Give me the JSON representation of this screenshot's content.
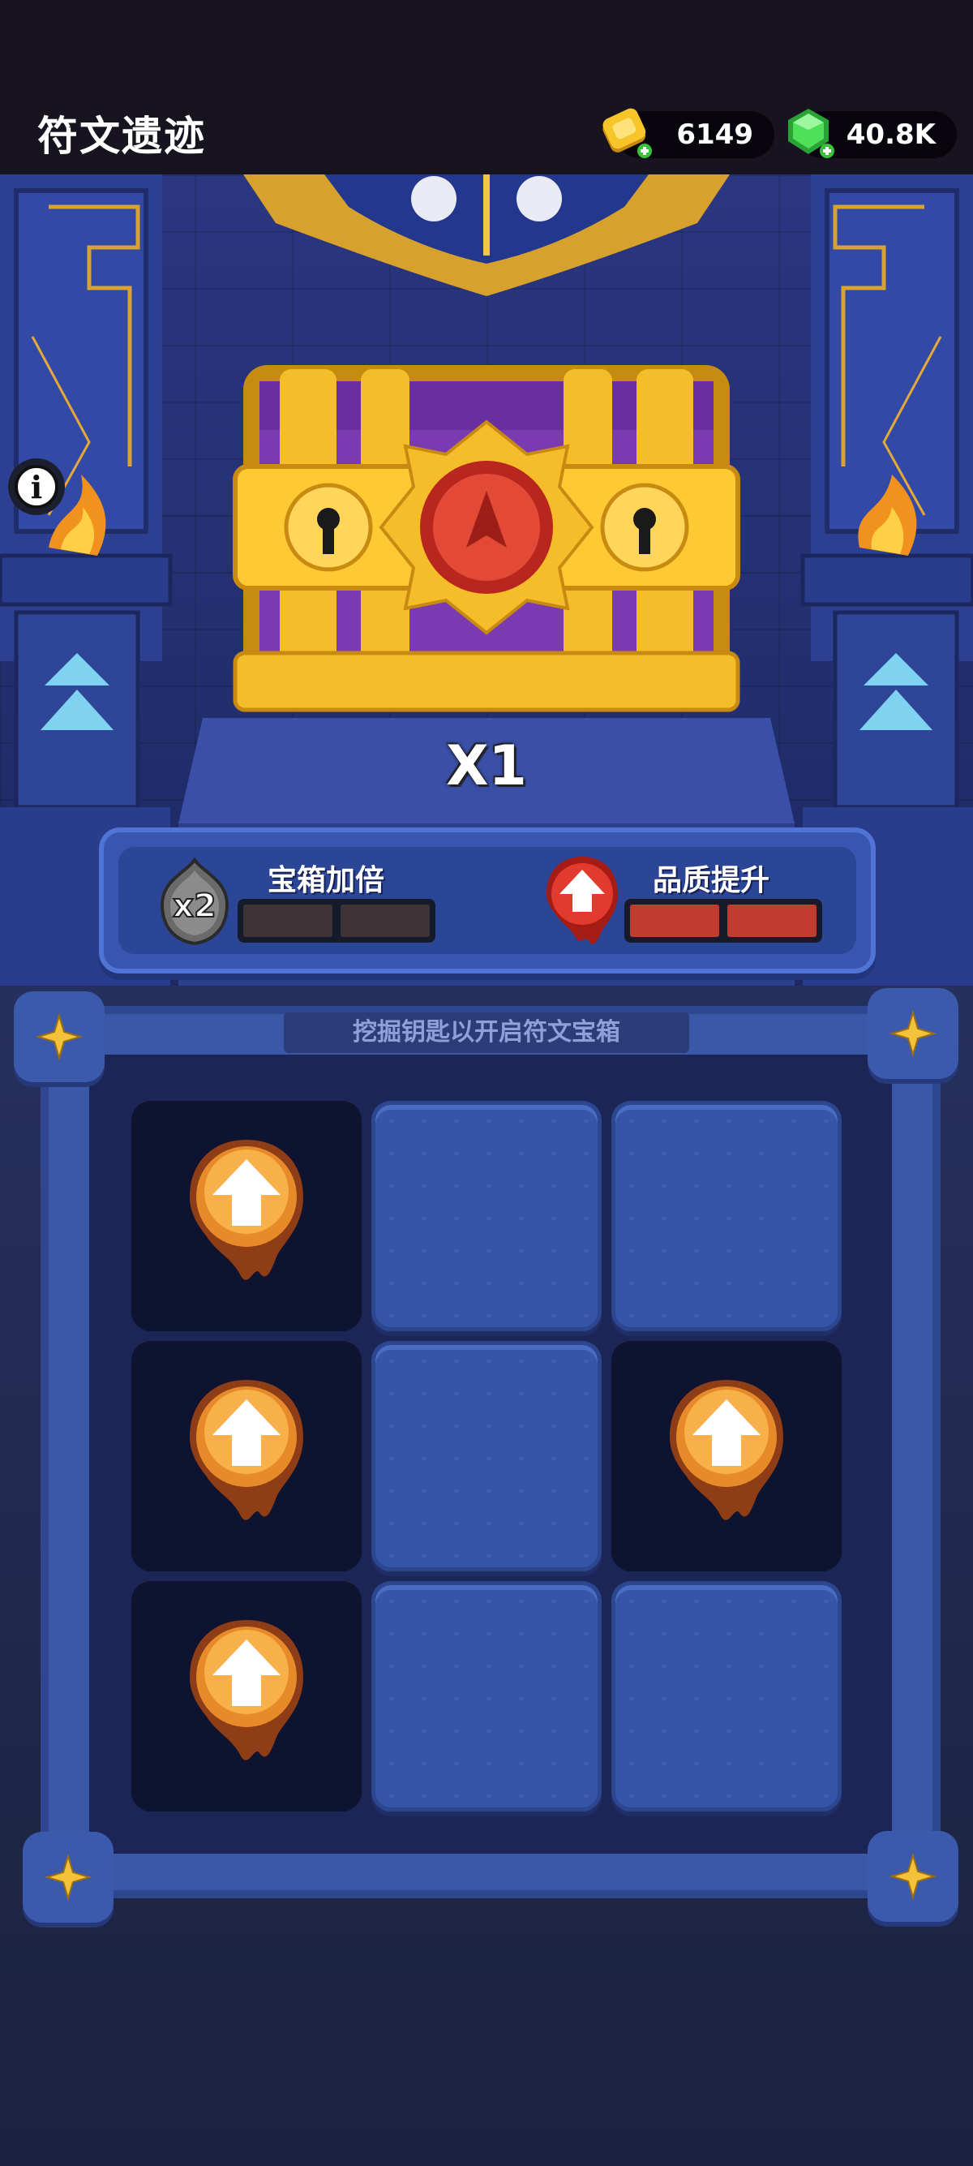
{
  "header": {
    "title": "符文遗迹",
    "gold_amount": "6149",
    "gem_amount": "40.8K"
  },
  "chest": {
    "multiplier_label": "X1"
  },
  "boosts": {
    "chest_double": {
      "badge": "x2",
      "label": "宝箱加倍",
      "progress": 0,
      "segments": 2
    },
    "quality_up": {
      "label": "品质提升",
      "progress": 1,
      "segments": 2
    }
  },
  "board": {
    "caption": "挖掘钥匙以开启符文宝箱",
    "cells": [
      {
        "state": "revealed",
        "item": "quality-up-rune"
      },
      {
        "state": "covered"
      },
      {
        "state": "covered"
      },
      {
        "state": "revealed",
        "item": "quality-up-rune"
      },
      {
        "state": "covered"
      },
      {
        "state": "revealed",
        "item": "quality-up-rune"
      },
      {
        "state": "revealed",
        "item": "quality-up-rune"
      },
      {
        "state": "covered"
      },
      {
        "state": "covered"
      }
    ]
  },
  "colors": {
    "background": "#1a1f3a",
    "panel": "#3856b0",
    "gold": "#f2b21d",
    "gem": "#3fd24a",
    "progress_fill": "#c23d30",
    "chest_purple": "#7a3bb0"
  },
  "icons": {
    "gold": "gold-coin-icon",
    "gem": "green-gem-icon",
    "info": "info-icon",
    "rune": "quality-up-rune-icon",
    "corner": "four-point-star-icon"
  }
}
